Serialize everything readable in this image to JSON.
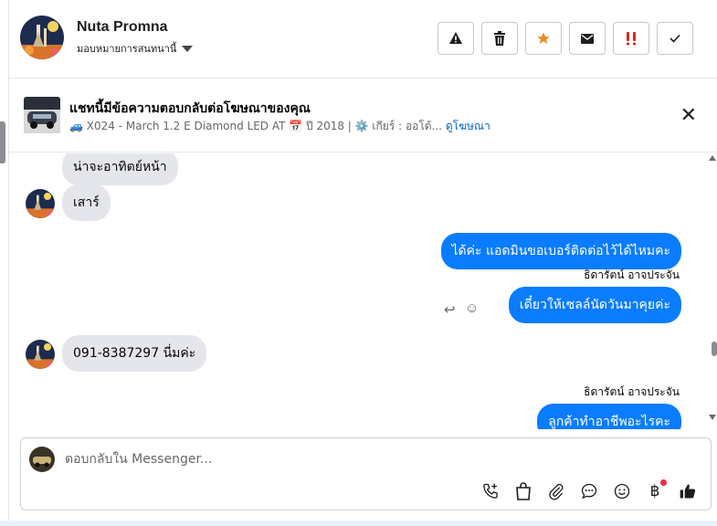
{
  "contact": {
    "name": "Nuta Promna",
    "assignment": "มอบหมายการสนทนานี้"
  },
  "actions": [
    {
      "icon": "warning-icon"
    },
    {
      "icon": "trash-icon"
    },
    {
      "icon": "star-icon"
    },
    {
      "icon": "mail-icon"
    },
    {
      "icon": "urgent-icon"
    },
    {
      "icon": "check-icon"
    }
  ],
  "ad_banner": {
    "title": "แชทนี้มีข้อความตอบกลับต่อโฆษณาของคุณ",
    "details": "🚙 X024 - March 1.2 E Diamond LED AT 📅 ปี 2018 | ⚙️ เกียร์ : ออโต้...",
    "link": "ดูโฆษณา"
  },
  "messages": [
    {
      "side": "in",
      "text": "น่าจะอาทิตย์หน้า"
    },
    {
      "side": "in",
      "text": "เสาร์"
    },
    {
      "side": "out",
      "text": "ได้ค่ะ แอดมินขอเบอร์ติดต่อไว้ได้ไหมคะ"
    },
    {
      "side": "out",
      "sender": "ธิดารัตน์ อาจประจัน",
      "text": "เดี๋ยวให้เซลล์นัดวันมาคุยค่ะ"
    },
    {
      "side": "in",
      "text": "091-8387297 นี่มค่ะ"
    },
    {
      "side": "out",
      "sender": "ธิดารัตน์ อาจประจัน",
      "text": "ลูกค้าทำอาชีพอะไรคะ"
    }
  ],
  "composer": {
    "placeholder": "ตอบกลับใน Messenger...",
    "tools": [
      "call-add-icon",
      "shopping-bag-icon",
      "attachment-icon",
      "saved-reply-icon",
      "emoji-icon",
      "baht-icon",
      "like-icon"
    ]
  },
  "colors": {
    "outgoing_bubble": "#0a7cff",
    "incoming_bubble": "#e4e6eb",
    "link": "#0064d1",
    "star": "#f08a24",
    "urgent": "#e0241b"
  }
}
